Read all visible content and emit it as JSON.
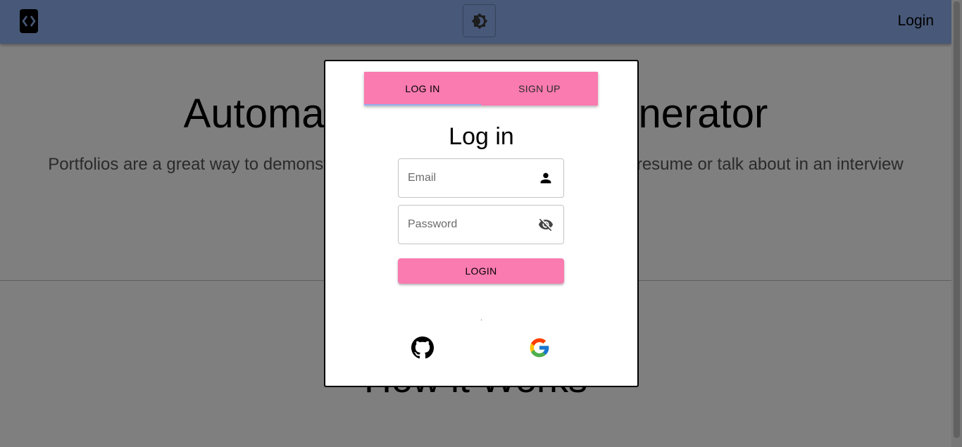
{
  "appbar": {
    "logo_icon": "code-brackets-icon",
    "theme_toggle_icon": "brightness-icon",
    "login_label": "Login",
    "color": "#90b1f1"
  },
  "hero": {
    "title_left": "Automa",
    "title_right": "nerator",
    "subtitle_left": "Portfolios are a great way to demonst",
    "subtitle_right": "resume or talk about in an interview"
  },
  "how_it_works": {
    "title": "How it Works"
  },
  "modal": {
    "tabs": [
      {
        "label": "LOG IN",
        "active": true
      },
      {
        "label": "SIGN UP",
        "active": false
      }
    ],
    "title": "Log in",
    "email": {
      "placeholder": "Email",
      "value": "",
      "icon": "person-icon"
    },
    "password": {
      "placeholder": "Password",
      "value": "",
      "icon": "eye-off-icon"
    },
    "login_button": "LOGIN",
    "social": [
      {
        "name": "github-icon"
      },
      {
        "name": "google-icon"
      }
    ],
    "accent_color": "#f97bb0",
    "tab_indicator_color": "#90b1f1"
  }
}
